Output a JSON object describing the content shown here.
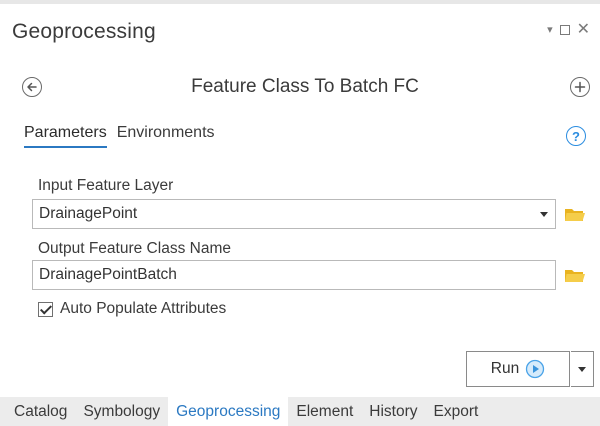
{
  "pane": {
    "title": "Geoprocessing",
    "controls": {
      "pin": "▾",
      "maximize": "",
      "close": "✕"
    }
  },
  "tool": {
    "title": "Feature Class To Batch FC",
    "back_icon": "back-arrow-icon",
    "add_icon": "plus-icon"
  },
  "tabs": [
    {
      "label": "Parameters",
      "active": true
    },
    {
      "label": "Environments",
      "active": false
    }
  ],
  "help_symbol": "?",
  "params": {
    "input_label": "Input Feature Layer",
    "input_value": "DrainagePoint",
    "output_label": "Output Feature Class Name",
    "output_value": "DrainagePointBatch",
    "checkbox_label": "Auto Populate Attributes",
    "checkbox_checked": true
  },
  "run": {
    "label": "Run"
  },
  "bottom_tabs": [
    {
      "label": "Catalog",
      "active": false
    },
    {
      "label": "Symbology",
      "active": false
    },
    {
      "label": "Geoprocessing",
      "active": true
    },
    {
      "label": "Element",
      "active": false
    },
    {
      "label": "History",
      "active": false
    },
    {
      "label": "Export",
      "active": false
    }
  ],
  "colors": {
    "accent": "#2b79c2",
    "help": "#2b8de0",
    "folder": "#f2c230",
    "run_icon": "#4aa3e8"
  }
}
